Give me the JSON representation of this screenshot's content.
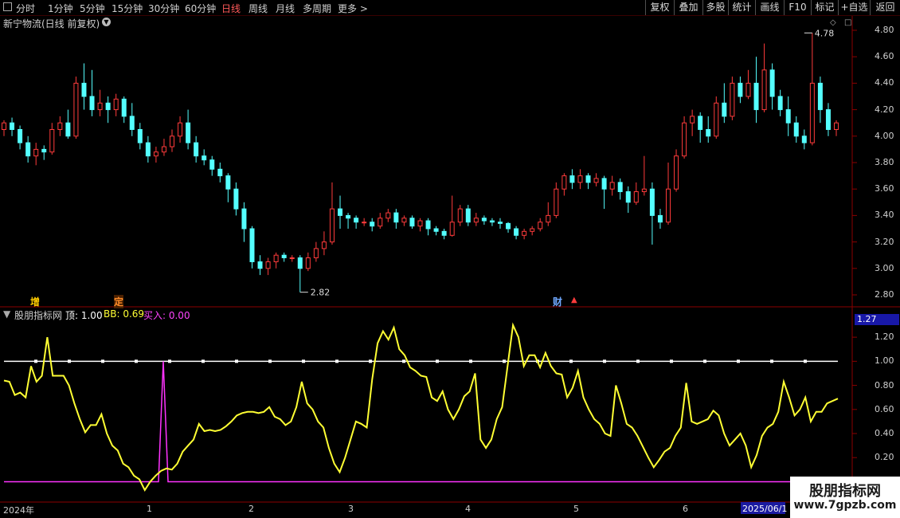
{
  "toolbar": {
    "periods": [
      "分时",
      "1分钟",
      "5分钟",
      "15分钟",
      "30分钟",
      "60分钟",
      "日线",
      "周线",
      "月线",
      "多周期",
      "更多 >"
    ],
    "active_period": "日线",
    "buttons": [
      "复权",
      "叠加",
      "多股",
      "统计",
      "画线",
      "F10",
      "标记",
      "+自选",
      "返回"
    ]
  },
  "stock": {
    "title": "新宁物流(日线 前复权)"
  },
  "price_axis": [
    "4.80",
    "4.60",
    "4.40",
    "4.20",
    "4.00",
    "3.80",
    "3.60",
    "3.40",
    "3.20",
    "3.00",
    "2.80"
  ],
  "price_annotations": {
    "high": "4.78",
    "low": "2.82"
  },
  "markers": {
    "zeng": "增",
    "ding": "定",
    "cai": "财"
  },
  "indicator": {
    "name": "股朋指标网",
    "top_label": "顶: 1.00",
    "bb_label": "BB: 0.69",
    "buy_label": "买入: 0.00",
    "current_value": "1.27",
    "axis": [
      "1.20",
      "1.00",
      "0.80",
      "0.60",
      "0.40",
      "0.20"
    ]
  },
  "dates": [
    "2024年",
    "1",
    "2",
    "3",
    "4",
    "5",
    "6",
    "2025/06/1"
  ],
  "watermark": {
    "line1": "股朋指标网",
    "line2": "www.7gpzb.com"
  },
  "colors": {
    "up": "#ff3b3b",
    "down": "#54ffff",
    "bb_line": "#ffff33",
    "top_line": "#ffffff",
    "buy_line": "#ff33ff",
    "frame": "#8b0000"
  },
  "chart_data": [
    {
      "type": "candlestick",
      "title": "新宁物流(日线 前复权)",
      "ylim": [
        2.75,
        4.85
      ],
      "high_label": 4.78,
      "low_label": 2.82,
      "candles": [
        [
          4.05,
          4.1,
          4.0,
          4.12
        ],
        [
          4.1,
          4.05,
          4.0,
          4.14
        ],
        [
          4.05,
          3.95,
          3.9,
          4.08
        ],
        [
          3.95,
          3.85,
          3.8,
          4.0
        ],
        [
          3.85,
          3.9,
          3.78,
          3.95
        ],
        [
          3.9,
          3.88,
          3.82,
          3.93
        ],
        [
          3.88,
          4.05,
          3.86,
          4.1
        ],
        [
          4.05,
          4.1,
          4.0,
          4.15
        ],
        [
          4.1,
          4.0,
          3.98,
          4.2
        ],
        [
          4.0,
          4.4,
          3.98,
          4.45
        ],
        [
          4.4,
          4.3,
          4.2,
          4.55
        ],
        [
          4.3,
          4.2,
          4.15,
          4.5
        ],
        [
          4.2,
          4.25,
          4.15,
          4.35
        ],
        [
          4.25,
          4.2,
          4.1,
          4.3
        ],
        [
          4.2,
          4.28,
          4.15,
          4.32
        ],
        [
          4.28,
          4.15,
          4.1,
          4.3
        ],
        [
          4.15,
          4.05,
          4.0,
          4.25
        ],
        [
          4.05,
          3.95,
          3.9,
          4.1
        ],
        [
          3.95,
          3.85,
          3.8,
          4.0
        ],
        [
          3.85,
          3.88,
          3.8,
          3.92
        ],
        [
          3.88,
          3.92,
          3.85,
          3.98
        ],
        [
          3.92,
          4.0,
          3.88,
          4.05
        ],
        [
          4.0,
          4.1,
          3.95,
          4.15
        ],
        [
          4.1,
          3.95,
          3.9,
          4.2
        ],
        [
          3.95,
          3.85,
          3.8,
          4.0
        ],
        [
          3.85,
          3.82,
          3.78,
          3.9
        ],
        [
          3.82,
          3.75,
          3.7,
          3.85
        ],
        [
          3.75,
          3.7,
          3.65,
          3.8
        ],
        [
          3.7,
          3.6,
          3.5,
          3.72
        ],
        [
          3.6,
          3.45,
          3.4,
          3.65
        ],
        [
          3.45,
          3.3,
          3.2,
          3.5
        ],
        [
          3.3,
          3.05,
          3.0,
          3.32
        ],
        [
          3.05,
          3.0,
          2.95,
          3.1
        ],
        [
          3.0,
          3.05,
          2.95,
          3.08
        ],
        [
          3.05,
          3.1,
          3.0,
          3.12
        ],
        [
          3.1,
          3.08,
          3.05,
          3.12
        ],
        [
          3.08,
          3.08,
          3.05,
          3.1
        ],
        [
          3.08,
          3.0,
          2.82,
          3.1
        ],
        [
          3.0,
          3.08,
          2.98,
          3.12
        ],
        [
          3.08,
          3.15,
          3.05,
          3.2
        ],
        [
          3.15,
          3.2,
          3.1,
          3.28
        ],
        [
          3.2,
          3.45,
          3.18,
          3.65
        ],
        [
          3.45,
          3.4,
          3.3,
          3.55
        ],
        [
          3.4,
          3.38,
          3.3,
          3.42
        ],
        [
          3.38,
          3.35,
          3.3,
          3.4
        ],
        [
          3.35,
          3.35,
          3.32,
          3.38
        ],
        [
          3.35,
          3.32,
          3.28,
          3.38
        ],
        [
          3.32,
          3.38,
          3.3,
          3.42
        ],
        [
          3.38,
          3.42,
          3.35,
          3.45
        ],
        [
          3.42,
          3.35,
          3.3,
          3.45
        ],
        [
          3.35,
          3.38,
          3.32,
          3.4
        ],
        [
          3.38,
          3.32,
          3.3,
          3.4
        ],
        [
          3.32,
          3.36,
          3.28,
          3.38
        ],
        [
          3.36,
          3.3,
          3.25,
          3.38
        ],
        [
          3.3,
          3.28,
          3.25,
          3.32
        ],
        [
          3.28,
          3.25,
          3.22,
          3.3
        ],
        [
          3.25,
          3.35,
          3.24,
          3.55
        ],
        [
          3.35,
          3.45,
          3.32,
          3.48
        ],
        [
          3.45,
          3.35,
          3.32,
          3.48
        ],
        [
          3.35,
          3.38,
          3.32,
          3.42
        ],
        [
          3.38,
          3.36,
          3.33,
          3.4
        ],
        [
          3.36,
          3.35,
          3.32,
          3.38
        ],
        [
          3.35,
          3.34,
          3.3,
          3.38
        ],
        [
          3.34,
          3.3,
          3.27,
          3.35
        ],
        [
          3.3,
          3.25,
          3.22,
          3.32
        ],
        [
          3.25,
          3.28,
          3.22,
          3.3
        ],
        [
          3.28,
          3.3,
          3.25,
          3.32
        ],
        [
          3.3,
          3.35,
          3.28,
          3.38
        ],
        [
          3.35,
          3.4,
          3.32,
          3.5
        ],
        [
          3.4,
          3.6,
          3.38,
          3.65
        ],
        [
          3.6,
          3.7,
          3.55,
          3.72
        ],
        [
          3.7,
          3.65,
          3.6,
          3.75
        ],
        [
          3.65,
          3.7,
          3.6,
          3.75
        ],
        [
          3.7,
          3.65,
          3.6,
          3.72
        ],
        [
          3.65,
          3.68,
          3.62,
          3.72
        ],
        [
          3.68,
          3.6,
          3.45,
          3.7
        ],
        [
          3.6,
          3.65,
          3.55,
          3.7
        ],
        [
          3.65,
          3.58,
          3.52,
          3.68
        ],
        [
          3.58,
          3.5,
          3.42,
          3.62
        ],
        [
          3.5,
          3.58,
          3.48,
          3.65
        ],
        [
          3.58,
          3.6,
          3.55,
          3.85
        ],
        [
          3.6,
          3.4,
          3.18,
          3.65
        ],
        [
          3.4,
          3.35,
          3.3,
          3.45
        ],
        [
          3.35,
          3.6,
          3.33,
          3.8
        ],
        [
          3.6,
          3.85,
          3.58,
          3.9
        ],
        [
          3.85,
          4.1,
          3.83,
          4.15
        ],
        [
          4.1,
          4.15,
          4.0,
          4.2
        ],
        [
          4.15,
          4.05,
          3.95,
          4.18
        ],
        [
          4.05,
          4.0,
          3.95,
          4.15
        ],
        [
          4.0,
          4.25,
          3.98,
          4.3
        ],
        [
          4.25,
          4.15,
          4.1,
          4.4
        ],
        [
          4.15,
          4.4,
          4.12,
          4.45
        ],
        [
          4.4,
          4.3,
          4.25,
          4.45
        ],
        [
          4.3,
          4.4,
          4.28,
          4.5
        ],
        [
          4.4,
          4.2,
          4.1,
          4.6
        ],
        [
          4.2,
          4.5,
          4.18,
          4.7
        ],
        [
          4.5,
          4.3,
          4.2,
          4.55
        ],
        [
          4.3,
          4.2,
          4.15,
          4.35
        ],
        [
          4.2,
          4.1,
          4.0,
          4.3
        ],
        [
          4.1,
          4.0,
          3.95,
          4.15
        ],
        [
          4.0,
          3.95,
          3.9,
          4.05
        ],
        [
          3.95,
          4.4,
          3.93,
          4.78
        ],
        [
          4.4,
          4.2,
          4.1,
          4.45
        ],
        [
          4.2,
          4.05,
          4.0,
          4.25
        ],
        [
          4.05,
          4.1,
          4.0,
          4.12
        ]
      ]
    },
    {
      "type": "line",
      "title": "股朋指标网",
      "ylim": [
        -0.05,
        1.35
      ],
      "series": [
        {
          "name": "顶",
          "values": [
            1.0
          ]
        },
        {
          "name": "BB",
          "values": [
            0.84,
            0.83,
            0.72,
            0.74,
            0.7,
            0.96,
            0.83,
            0.88,
            1.2,
            0.88,
            0.88,
            0.88,
            0.8,
            0.65,
            0.52,
            0.41,
            0.47,
            0.47,
            0.56,
            0.4,
            0.3,
            0.26,
            0.15,
            0.12,
            0.05,
            0.02,
            -0.07,
            0.0,
            0.05,
            0.09,
            0.11,
            0.1,
            0.15,
            0.25,
            0.3,
            0.35,
            0.48,
            0.42,
            0.43,
            0.42,
            0.43,
            0.46,
            0.5,
            0.55,
            0.57,
            0.58,
            0.58,
            0.57,
            0.58,
            0.62,
            0.54,
            0.52,
            0.47,
            0.5,
            0.62,
            0.83,
            0.65,
            0.6,
            0.5,
            0.45,
            0.28,
            0.15,
            0.08,
            0.2,
            0.35,
            0.5,
            0.48,
            0.45,
            0.85,
            1.15,
            1.25,
            1.18,
            1.28,
            1.1,
            1.05,
            0.95,
            0.92,
            0.88,
            0.87,
            0.7,
            0.67,
            0.75,
            0.6,
            0.52,
            0.6,
            0.71,
            0.75,
            0.9,
            0.35,
            0.28,
            0.35,
            0.52,
            0.62,
            0.96,
            1.3,
            1.2,
            0.96,
            1.05,
            1.05,
            0.95,
            1.07,
            0.96,
            0.9,
            0.89,
            0.7,
            0.78,
            0.92,
            0.7,
            0.6,
            0.52,
            0.48,
            0.4,
            0.38,
            0.8,
            0.65,
            0.48,
            0.45,
            0.38,
            0.29,
            0.2,
            0.12,
            0.18,
            0.25,
            0.28,
            0.38,
            0.45,
            0.82,
            0.5,
            0.48,
            0.5,
            0.52,
            0.59,
            0.55,
            0.4,
            0.3,
            0.35,
            0.4,
            0.3,
            0.12,
            0.22,
            0.38,
            0.45,
            0.48,
            0.58,
            0.83,
            0.7,
            0.55,
            0.6,
            0.7,
            0.5,
            0.58,
            0.58,
            0.65,
            0.67,
            0.69
          ]
        },
        {
          "name": "买入",
          "values": [
            0.0
          ]
        }
      ],
      "buy_spike": {
        "peak": 1.0
      }
    }
  ]
}
